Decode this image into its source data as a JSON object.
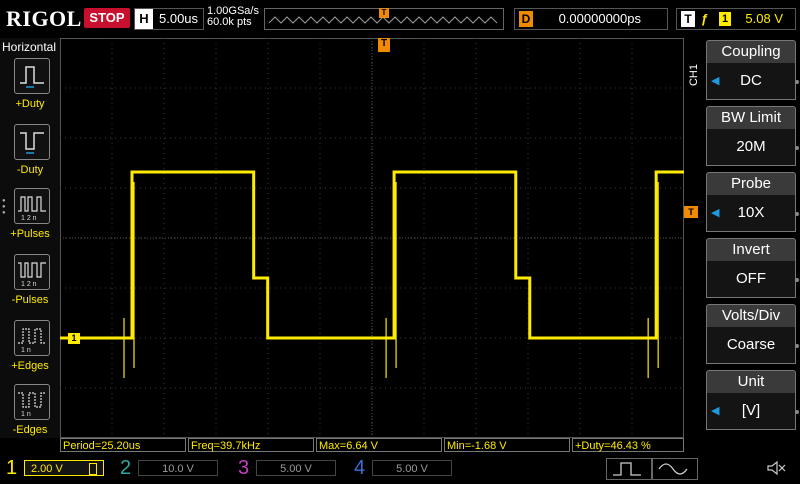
{
  "header": {
    "brand": "RIGOL",
    "run_state": "STOP",
    "timebase_label": "H",
    "timebase_value": "5.00us",
    "sample_rate": "1.00GSa/s",
    "memory_depth": "60.0k pts",
    "trigger_marker": "T",
    "delay_label": "D",
    "delay_value": "0.00000000ps",
    "trigger_label": "T",
    "trigger_edge": "ƒ",
    "trigger_source": "1",
    "trigger_level": "5.08 V"
  },
  "left_panel": {
    "title": "Horizontal",
    "items": [
      {
        "label": "+Duty",
        "icon": "pos-duty-icon"
      },
      {
        "label": "-Duty",
        "icon": "neg-duty-icon"
      },
      {
        "label": "+Pulses",
        "icon": "pos-pulses-icon",
        "sub": "1 2 n"
      },
      {
        "label": "-Pulses",
        "icon": "neg-pulses-icon",
        "sub": "1 2 n"
      },
      {
        "label": "+Edges",
        "icon": "pos-edges-icon",
        "sub": "1 n"
      },
      {
        "label": "-Edges",
        "icon": "neg-edges-icon",
        "sub": "1 n"
      }
    ]
  },
  "right_menu": {
    "channel": "CH1",
    "items": [
      {
        "label": "Coupling",
        "value": "DC",
        "arrow": true
      },
      {
        "label": "BW Limit",
        "value": "20M",
        "arrow": false
      },
      {
        "label": "Probe",
        "value": "10X",
        "arrow": true
      },
      {
        "label": "Invert",
        "value": "OFF",
        "arrow": false
      },
      {
        "label": "Volts/Div",
        "value": "Coarse",
        "arrow": false
      },
      {
        "label": "Unit",
        "value": "[V]",
        "arrow": true
      }
    ]
  },
  "waveform": {
    "channel_marker": "1",
    "trigger_level_marker": "T",
    "color": "#ffeb00",
    "period_us": 25.2,
    "duty_percent": 46.43,
    "high_level_v": 6.64,
    "low_level_v": 0
  },
  "measurements": [
    {
      "text": "Period=25.20us"
    },
    {
      "text": "Freq=39.7kHz"
    },
    {
      "text": "Max=6.64 V"
    },
    {
      "text": "Min=-1.68 V"
    },
    {
      "text": "+Duty=46.43 %"
    }
  ],
  "channels": [
    {
      "num": "1",
      "scale": "2.00 V",
      "color": "#ffeb00",
      "active": true
    },
    {
      "num": "2",
      "scale": "10.0 V",
      "color": "#2fa8a0",
      "active": false
    },
    {
      "num": "3",
      "scale": "5.00 V",
      "color": "#c040c0",
      "active": false
    },
    {
      "num": "4",
      "scale": "5.00 V",
      "color": "#3b6fd8",
      "active": false
    }
  ]
}
